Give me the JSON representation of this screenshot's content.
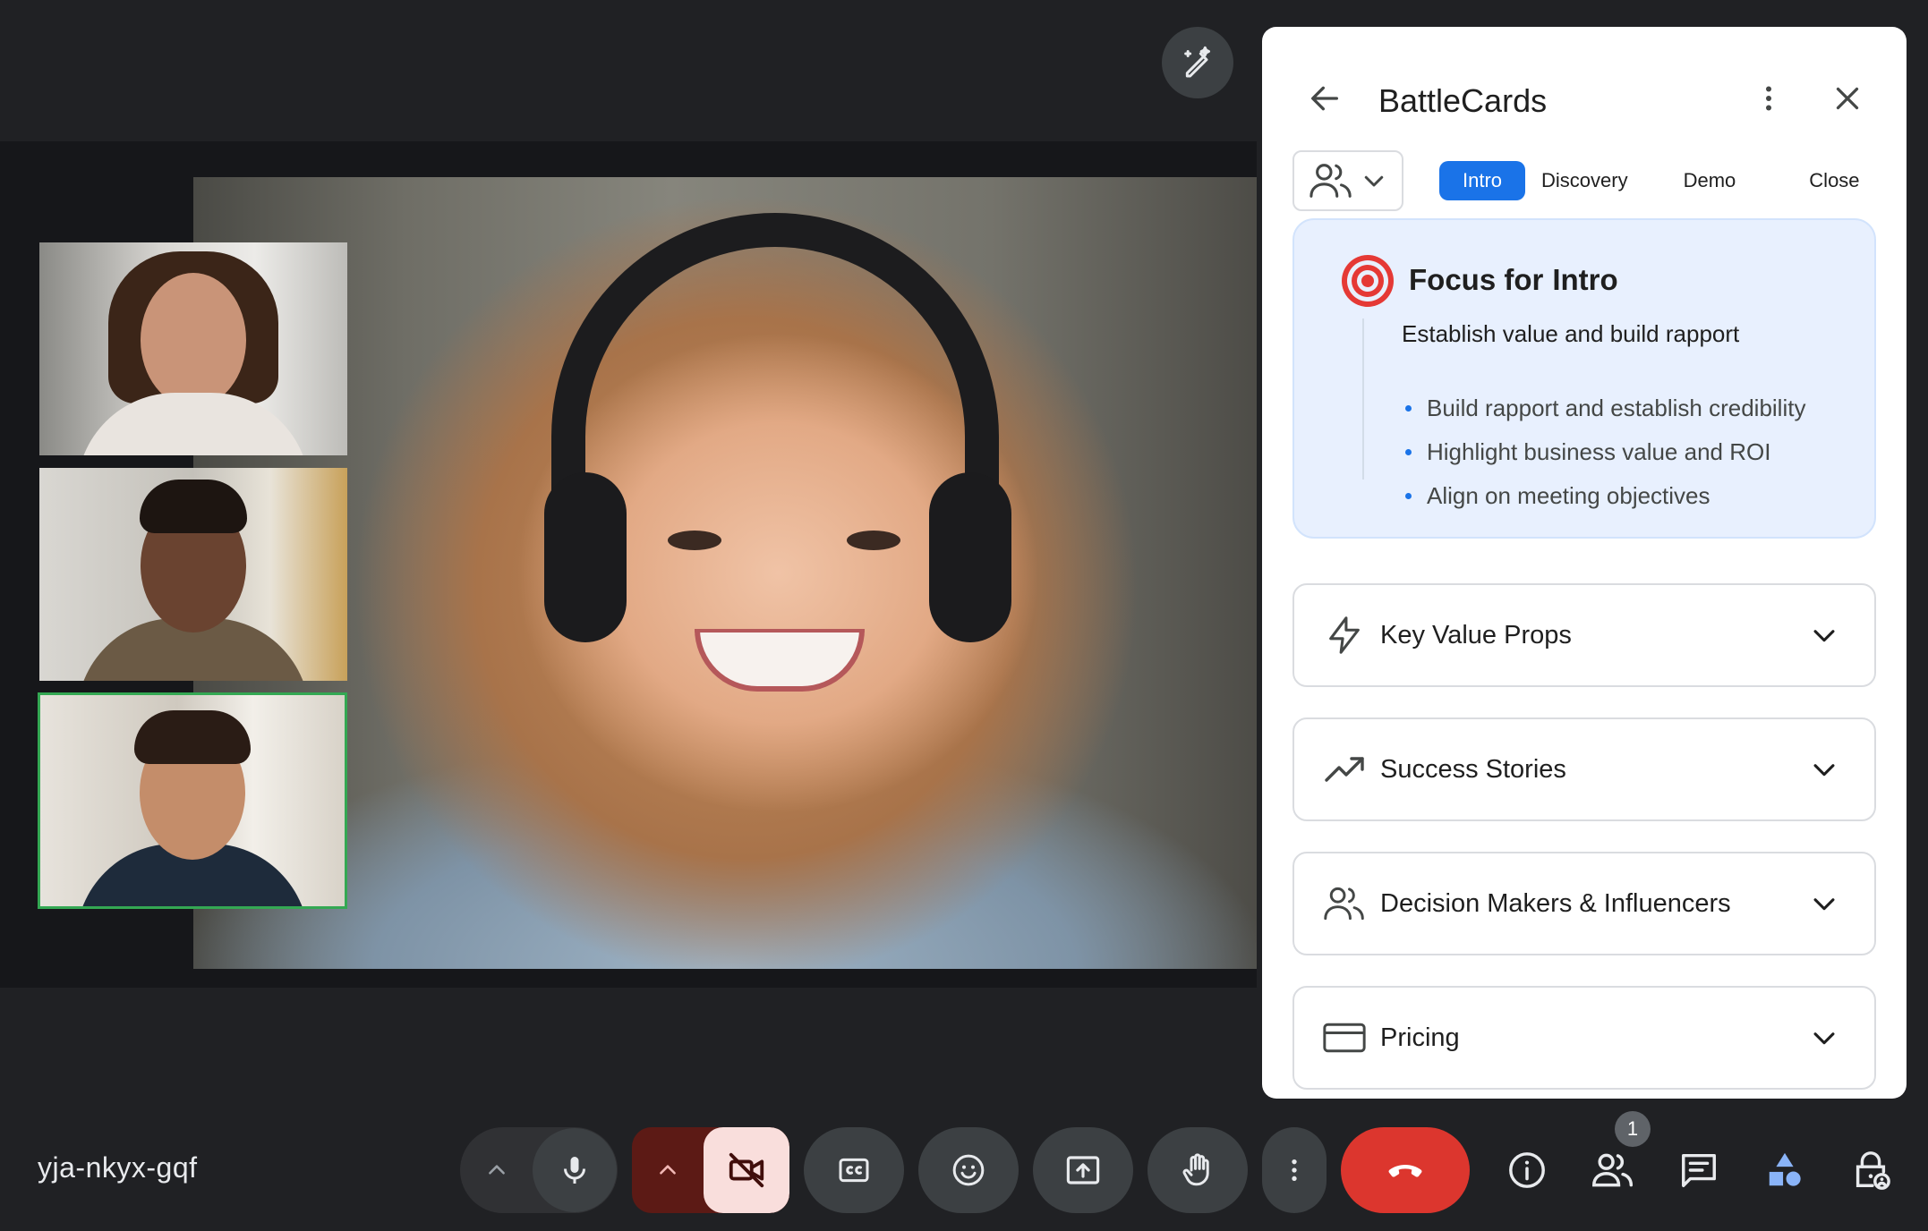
{
  "meeting": {
    "code": "yja-nkyx-gqf"
  },
  "stage": {
    "main_speaker": "main-video",
    "thumbnails": [
      "participant-1",
      "participant-2",
      "participant-3"
    ],
    "active_thumbnail_color": "#34a853"
  },
  "effects_button": {
    "icon": "wand-pencil-icon"
  },
  "panel": {
    "title": "BattleCards",
    "tabs": [
      {
        "label": "Intro",
        "active": true
      },
      {
        "label": "Discovery",
        "active": false
      },
      {
        "label": "Demo",
        "active": false
      },
      {
        "label": "Close",
        "active": false
      }
    ],
    "focus": {
      "prefix": "Focus for",
      "stage": "Intro",
      "subtitle": "Establish value and build rapport",
      "bullets": [
        "Build rapport and establish credibility",
        "Highlight business value and ROI",
        "Align on meeting objectives"
      ]
    },
    "sections": [
      {
        "label": "Key Value Props",
        "icon": "lightning-icon"
      },
      {
        "label": "Success Stories",
        "icon": "trending-up-icon"
      },
      {
        "label": "Decision Makers & Influencers",
        "icon": "people-icon"
      },
      {
        "label": "Pricing",
        "icon": "credit-card-icon"
      }
    ]
  },
  "controls": {
    "people_count": "1"
  },
  "colors": {
    "accent": "#1a73e8",
    "leave": "#dc362e",
    "camera_off_bg": "#f9dedc",
    "camera_group_bg": "#5c1a15",
    "focus_bg": "#e8f0fe",
    "target_red": "#e53935"
  }
}
